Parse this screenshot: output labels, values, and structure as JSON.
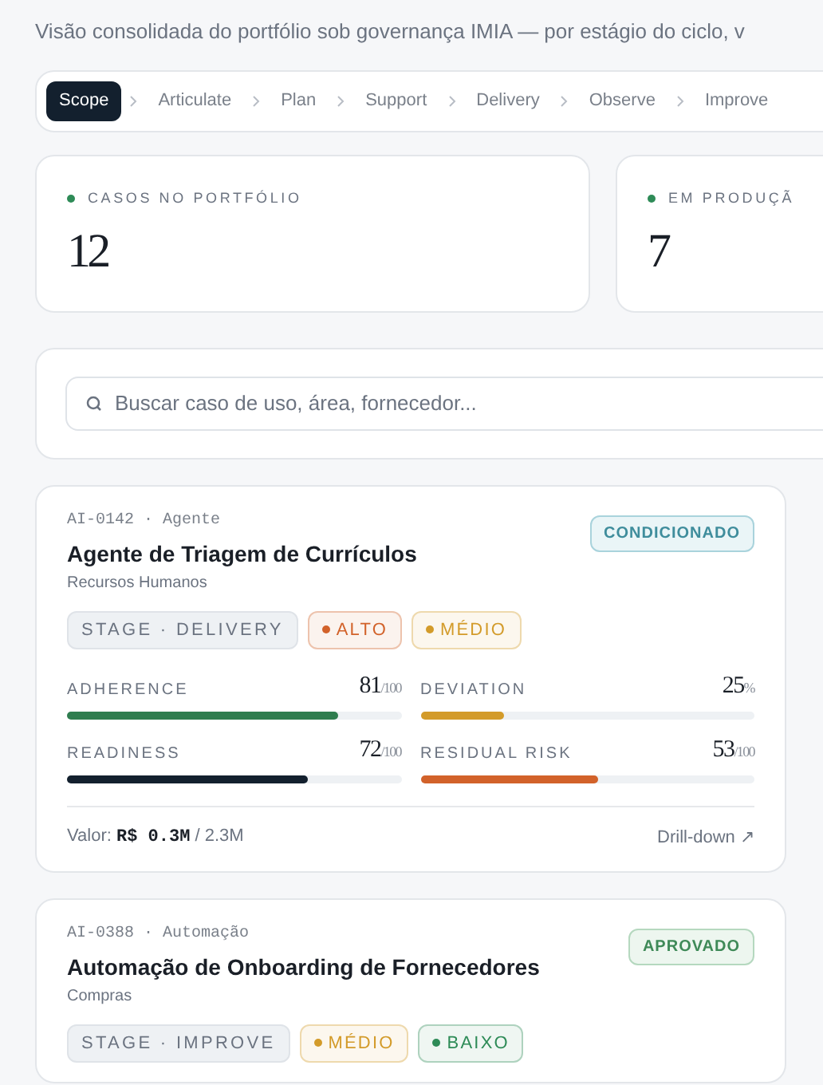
{
  "subtitle": "Visão consolidada do portfólio sob governança IMIA — por estágio do ciclo, v",
  "stages": [
    {
      "label": "Scope",
      "selected": true
    },
    {
      "label": "Articulate",
      "selected": false
    },
    {
      "label": "Plan",
      "selected": false
    },
    {
      "label": "Support",
      "selected": false
    },
    {
      "label": "Delivery",
      "selected": false
    },
    {
      "label": "Observe",
      "selected": false
    },
    {
      "label": "Improve",
      "selected": false
    }
  ],
  "kpis": [
    {
      "label": "CASOS NO PORTFÓLIO",
      "value": "12",
      "color": "#2e8b57"
    },
    {
      "label": "EM PRODUÇÃ",
      "value": "7",
      "color": "#2e8b57"
    }
  ],
  "search": {
    "placeholder": "Buscar caso de uso, área, fornecedor..."
  },
  "cases": [
    {
      "meta": "AI-0142 · Agente",
      "title": "Agente de Triagem de Currículos",
      "area": "Recursos Humanos",
      "status": {
        "label": "CONDICIONADO",
        "kind": "conditioned"
      },
      "tags": [
        {
          "label": "STAGE · DELIVERY",
          "kind": "stage"
        },
        {
          "label": "ALTO",
          "kind": "level",
          "color": "#d2622a"
        },
        {
          "label": "MÉDIO",
          "kind": "level",
          "color": "#d39b2a"
        }
      ],
      "metrics": [
        {
          "label": "ADHERENCE",
          "value": "81",
          "unit": "/100",
          "level": 0.81,
          "color": "#2f7d4f"
        },
        {
          "label": "DEVIATION",
          "value": "25",
          "unit": "%",
          "level": 0.25,
          "color": "#d39b2a"
        },
        {
          "label": "READINESS",
          "value": "72",
          "unit": "/100",
          "level": 0.72,
          "color": "#13202e"
        },
        {
          "label": "RESIDUAL RISK",
          "value": "53",
          "unit": "/100",
          "level": 0.53,
          "color": "#d2622a"
        }
      ],
      "value_label": "Valor:",
      "value_amount": "R$ 0.3M",
      "value_total": "/ 2.3M",
      "action": "Drill-down ↗"
    },
    {
      "meta": "AI-0388 · Automação",
      "title": "Automação de Onboarding de Fornecedores",
      "area": "Compras",
      "status": {
        "label": "APROVADO",
        "kind": "approved"
      },
      "tags": [
        {
          "label": "STAGE · IMPROVE",
          "kind": "stage"
        },
        {
          "label": "MÉDIO",
          "kind": "level",
          "color": "#d39b2a"
        },
        {
          "label": "BAIXO",
          "kind": "level",
          "color": "#2e8b57"
        }
      ]
    }
  ]
}
